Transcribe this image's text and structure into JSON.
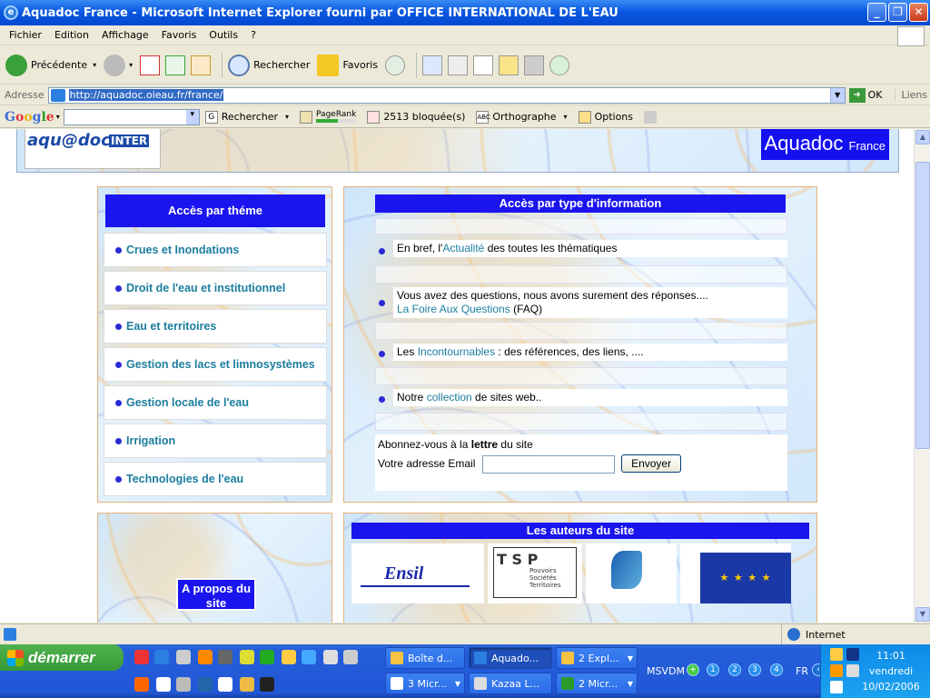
{
  "window": {
    "title": "Aquadoc France - Microsoft Internet Explorer fourni par OFFICE INTERNATIONAL DE L'EAU"
  },
  "menu": [
    "Fichier",
    "Edition",
    "Affichage",
    "Favoris",
    "Outils",
    "?"
  ],
  "toolbar": {
    "back": "Précédente",
    "search": "Rechercher",
    "favorites": "Favoris"
  },
  "address": {
    "label": "Adresse",
    "url": "http://aquadoc.oieau.fr/france/",
    "go": "OK",
    "links": "Liens"
  },
  "google": {
    "logo": "Google",
    "search": "Rechercher",
    "pagerank": "PageRank",
    "blocked": "2513 bloquée(s)",
    "spell": "Orthographe",
    "options": "Options"
  },
  "header": {
    "logo_text": "aqu@doc",
    "logo_inter": "INTER",
    "site_title": "Aquadoc",
    "site_sub": "France"
  },
  "themes": {
    "heading": "Accès par théme",
    "items": [
      "Crues et Inondations",
      "Droit de l'eau et institutionnel",
      "Eau et territoires",
      "Gestion des lacs et limnosystèmes",
      "Gestion locale de l'eau",
      "Irrigation",
      "Technologies de l'eau"
    ]
  },
  "info": {
    "heading": "Accès par type d'information",
    "item1": {
      "pre": "En bref, l'",
      "link": "Actualité",
      "post": " des toutes les thématiques"
    },
    "item2": {
      "line1": "Vous avez des questions, nous avons surement des réponses....",
      "link": "La Foire Aux Questions",
      "post": " (FAQ)"
    },
    "item3": {
      "pre": "Les ",
      "link": "Incontournables",
      "post": " : des références, des liens, ...."
    },
    "item4": {
      "pre": "Notre ",
      "link": "collection",
      "post": " de sites web.."
    },
    "newsletter": {
      "pre": "Abonnez-vous à la ",
      "bold": "lettre",
      "post": " du site",
      "email_label": "Votre adresse Email",
      "button": "Envoyer"
    }
  },
  "about": {
    "heading": "A propos du site"
  },
  "authors": {
    "heading": "Les auteurs du site",
    "logos": [
      "Ensil",
      "Pouvoirs Sociétés Territoires"
    ]
  },
  "status": {
    "zone": "Internet"
  },
  "taskbar": {
    "start": "démarrer",
    "tasks_row1": [
      "Boîte d...",
      "Aquado...",
      "2 Expl..."
    ],
    "tasks_row2": [
      "3 Micr...",
      "Kazaa L...",
      "2 Micr..."
    ],
    "msvdm": "MSVDM",
    "pages": [
      "1",
      "2",
      "3",
      "4"
    ],
    "lang": "FR",
    "time": "11:01",
    "day": "vendredi",
    "date": "10/02/2006"
  },
  "colors": {
    "accent": "#1a14ee",
    "link": "#1b7d9e",
    "title_bar": "#0a58e0",
    "taskbar": "#245edb"
  }
}
